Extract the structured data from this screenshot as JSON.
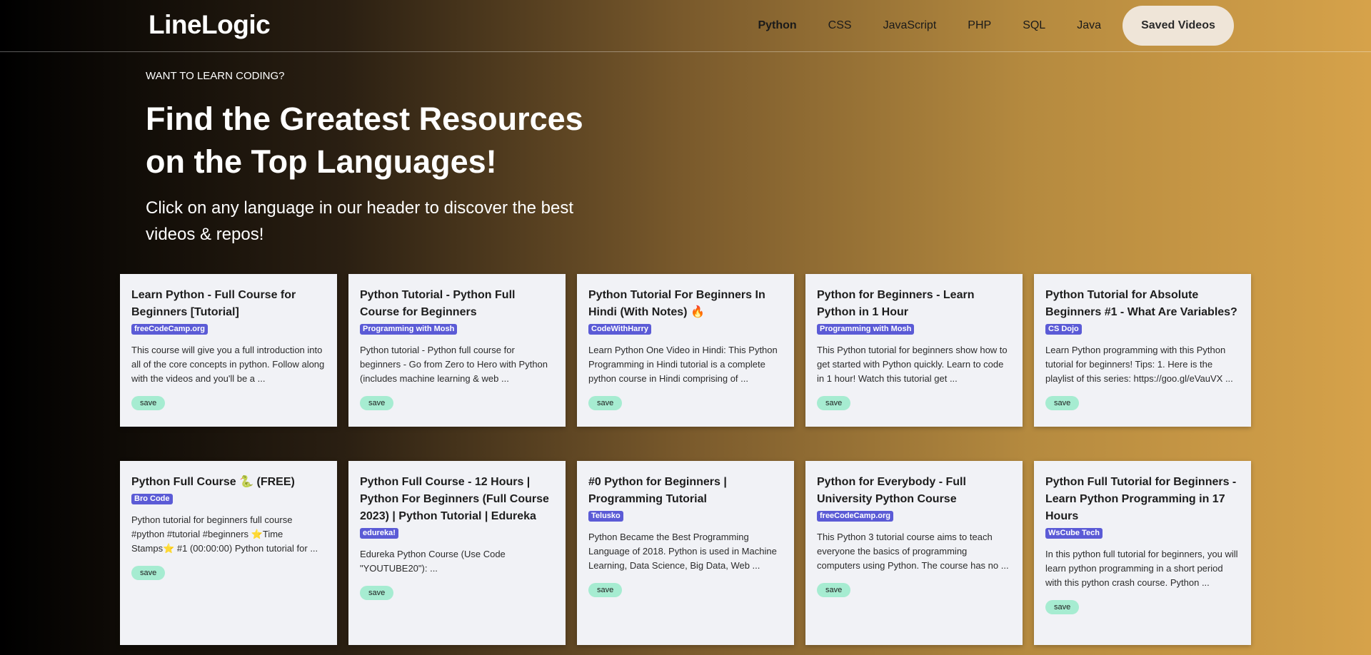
{
  "header": {
    "logo": "LineLogic",
    "nav": [
      "Python",
      "CSS",
      "JavaScript",
      "PHP",
      "SQL",
      "Java"
    ],
    "saved_label": "Saved Videos"
  },
  "hero": {
    "eyebrow": "WANT TO LEARN CODING?",
    "title": "Find the Greatest Resources on the Top Languages!",
    "subtitle": "Click on any language in our header to discover the best videos & repos!"
  },
  "cards": [
    {
      "title": "Learn Python - Full Course for Beginners [Tutorial]",
      "channel": "freeCodeCamp.org",
      "desc": "This course will give you a full introduction into all of the core concepts in python. Follow along with the videos and you'll be a ...",
      "save": "save"
    },
    {
      "title": "Python Tutorial - Python Full Course for Beginners",
      "channel": "Programming with Mosh",
      "desc": "Python tutorial - Python full course for beginners - Go from Zero to Hero with Python (includes machine learning & web ...",
      "save": "save"
    },
    {
      "title": "Python Tutorial For Beginners In Hindi (With Notes) 🔥",
      "channel": "CodeWithHarry",
      "desc": "Learn Python One Video in Hindi: This Python Programming in Hindi tutorial is a complete python course in Hindi comprising of ...",
      "save": "save"
    },
    {
      "title": "Python for Beginners - Learn Python in 1 Hour",
      "channel": "Programming with Mosh",
      "desc": "This Python tutorial for beginners show how to get started with Python quickly. Learn to code in 1 hour! Watch this tutorial get ...",
      "save": "save"
    },
    {
      "title": "Python Tutorial for Absolute Beginners #1 - What Are Variables?",
      "channel": "CS Dojo",
      "desc": "Learn Python programming with this Python tutorial for beginners! Tips: 1. Here is the playlist of this series: https://goo.gl/eVauVX ...",
      "save": "save"
    },
    {
      "title": "Python Full Course 🐍 (FREE)",
      "channel": "Bro Code",
      "desc": "Python tutorial for beginners full course #python #tutorial #beginners ⭐️Time Stamps⭐️ #1 (00:00:00) Python tutorial for ...",
      "save": "save"
    },
    {
      "title": "Python Full Course - 12 Hours | Python For Beginners (Full Course 2023) | Python Tutorial | Edureka",
      "channel": "edureka!",
      "desc": "Edureka Python Course (Use Code \"YOUTUBE20\"): ...",
      "save": "save"
    },
    {
      "title": "#0 Python for Beginners | Programming Tutorial",
      "channel": "Telusko",
      "desc": "Python Became the Best Programming Language of 2018. Python is used in Machine Learning, Data Science, Big Data, Web ...",
      "save": "save"
    },
    {
      "title": "Python for Everybody - Full University Python Course",
      "channel": "freeCodeCamp.org",
      "desc": "This Python 3 tutorial course aims to teach everyone the basics of programming computers using Python. The course has no ...",
      "save": "save"
    },
    {
      "title": "Python Full Tutorial for Beginners - Learn Python Programming in 17 Hours",
      "channel": "WsCube Tech",
      "desc": "In this python full tutorial for beginners, you will learn python programming in a short period with this python crash course. Python ...",
      "save": "save"
    }
  ]
}
